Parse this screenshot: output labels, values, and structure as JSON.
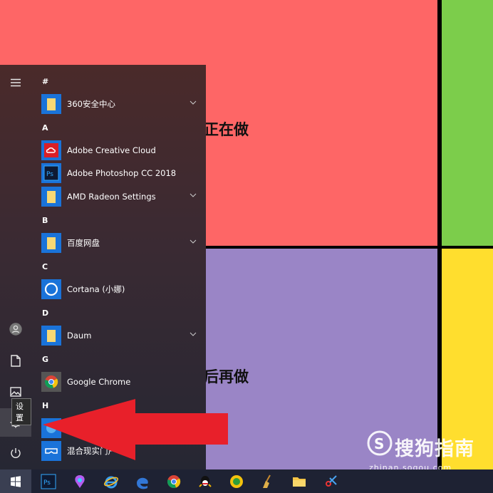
{
  "background": {
    "text_top": "正在做",
    "text_bottom": "后再做",
    "colors": {
      "red": "#fe6666",
      "green": "#7ccd4b",
      "purple": "#9a85c6",
      "yellow": "#ffde2e"
    }
  },
  "start_menu": {
    "tooltip": "设置",
    "groups": [
      {
        "letter": "#",
        "apps": [
          {
            "label": "360安全中心",
            "icon": "folder-icon",
            "expandable": true
          }
        ]
      },
      {
        "letter": "A",
        "apps": [
          {
            "label": "Adobe Creative Cloud",
            "icon": "creative-cloud-icon",
            "expandable": false
          },
          {
            "label": "Adobe Photoshop CC 2018",
            "icon": "photoshop-icon",
            "expandable": false
          },
          {
            "label": "AMD Radeon Settings",
            "icon": "folder-icon",
            "expandable": true
          }
        ]
      },
      {
        "letter": "B",
        "apps": [
          {
            "label": "百度网盘",
            "icon": "folder-icon",
            "expandable": true
          }
        ]
      },
      {
        "letter": "C",
        "apps": [
          {
            "label": "Cortana (小娜)",
            "icon": "cortana-icon",
            "expandable": false
          }
        ]
      },
      {
        "letter": "D",
        "apps": [
          {
            "label": "Daum",
            "icon": "folder-icon",
            "expandable": true
          }
        ]
      },
      {
        "letter": "G",
        "apps": [
          {
            "label": "Google Chrome",
            "icon": "chrome-icon",
            "expandable": false
          }
        ]
      },
      {
        "letter": "H",
        "apps": [
          {
            "label": "",
            "icon": "ie-icon",
            "expandable": false
          },
          {
            "label": "混合现实门户",
            "icon": "mixed-reality-icon",
            "expandable": false
          }
        ]
      }
    ]
  },
  "taskbar": {
    "icons": [
      "windows-start-icon",
      "photoshop-icon",
      "paint3d-icon",
      "internet-explorer-icon",
      "edge-icon",
      "chrome-icon",
      "qq-icon",
      "chat-icon",
      "cleaner-icon",
      "file-explorer-icon",
      "snipping-icon"
    ]
  },
  "watermark": {
    "main": "搜狗指南",
    "url": "zhinan.sogou.com"
  }
}
